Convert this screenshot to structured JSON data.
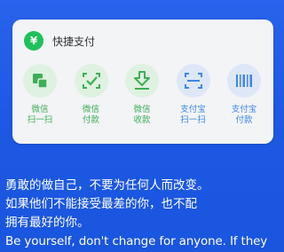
{
  "card": {
    "title": "快捷支付",
    "icon": "yen-icon",
    "accent_green": "#20c05c",
    "accent_blue": "#3f86e6",
    "actions": [
      {
        "line1": "微信",
        "line2": "扫一扫",
        "icon": "scan-square-icon",
        "color": "green"
      },
      {
        "line1": "微信",
        "line2": "付款",
        "icon": "check-square-icon",
        "color": "green"
      },
      {
        "line1": "微信",
        "line2": "收款",
        "icon": "arrow-down-box-icon",
        "color": "green"
      },
      {
        "line1": "支付宝",
        "line2": "扫一扫",
        "icon": "scan-frame-icon",
        "color": "blue"
      },
      {
        "line1": "支付宝",
        "line2": "付款",
        "icon": "barcode-icon",
        "color": "blue"
      }
    ]
  },
  "quote": {
    "line1": "勇敢的做自己，不要为任何人而改变。",
    "line2": "如果他们不能接受最差的你，也不配",
    "line3": "拥有最好的你。",
    "line4": "Be yourself, don't change for anyone. If they"
  }
}
